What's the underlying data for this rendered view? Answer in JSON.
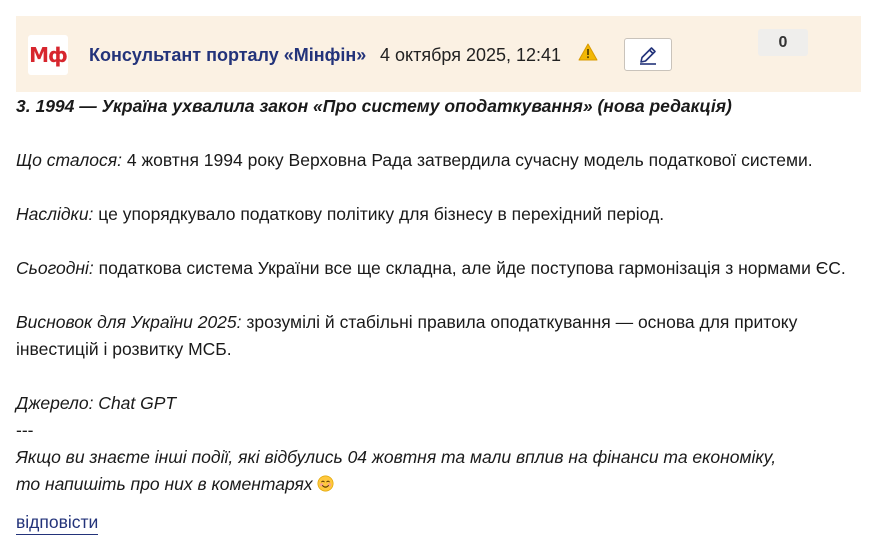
{
  "header": {
    "logo_text": "Мф",
    "author": "Консультант порталу «Мінфін»",
    "date": "4 октября 2025, 12:41",
    "warn_icon": "warning-icon",
    "edit_icon": "pencil-icon",
    "score": "0"
  },
  "post": {
    "title": "3. 1994 — Україна ухвалила закон «Про систему оподаткування» (нова редакція)",
    "what_label": "Що сталося:",
    "what_text": " 4 жовтня 1994 року Верховна Рада затвердила сучасну модель податкової системи.",
    "consequences_label": "Наслідки:",
    "consequences_text": " це упорядкувало податкову політику для бізнесу в перехідний період.",
    "today_label": "Сьогодні:",
    "today_text": " податкова система України все ще складна, але йде поступова гармонізація з нормами ЄС.",
    "conclusion_label": "Висновок для України 2025:",
    "conclusion_text_1": " зрозумілі й стабільні правила оподаткування — основа для притоку",
    "conclusion_text_2": "інвестицій і розвитку МСБ.",
    "source": "Джерело: Chat GPT",
    "divider": "---",
    "closing_1": "Якщо ви знаєте інші події, які відбулись 04 жовтня та мали вплив на фінанси та економіку,",
    "closing_2": "то напишіть про них в коментарях",
    "emoji_icon": "smiling-face-icon"
  },
  "actions": {
    "reply": "відповісти"
  },
  "colors": {
    "header_bg": "#fbf1e3",
    "author": "#23337a",
    "logo": "#d7262e",
    "warning": "#f2b705"
  }
}
